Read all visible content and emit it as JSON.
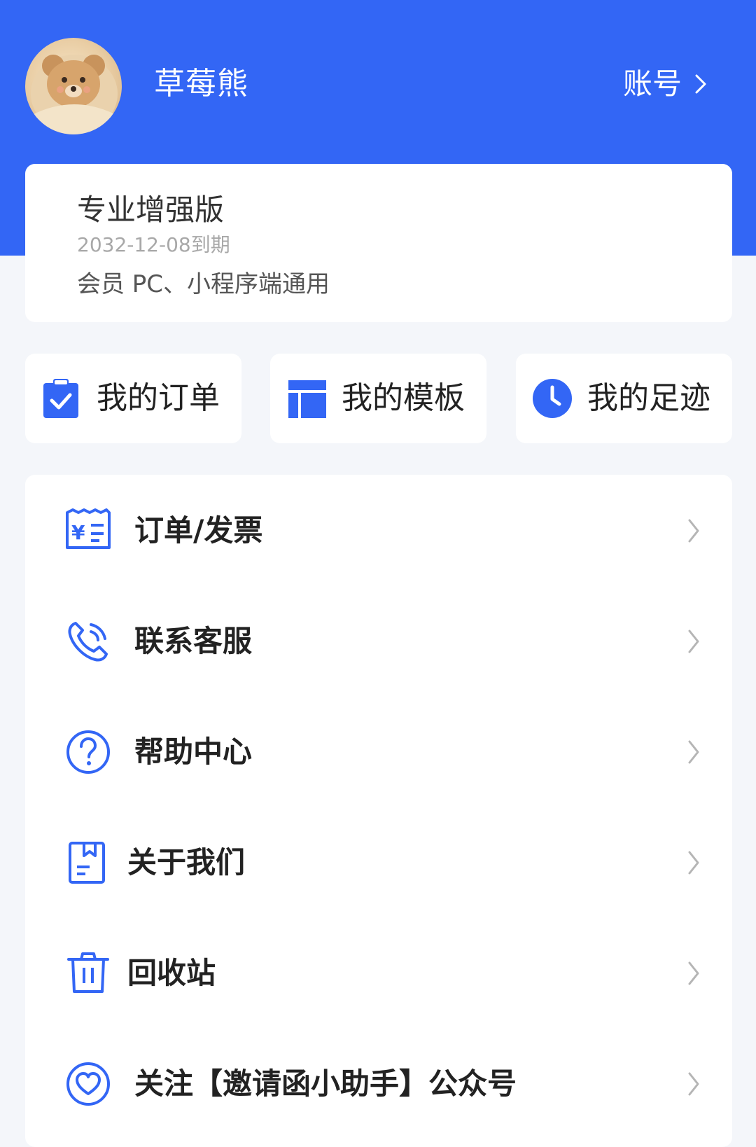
{
  "profile": {
    "username": "草莓熊",
    "account_label": "账号"
  },
  "membership": {
    "title": "专业增强版",
    "expire": "2032-12-08到期",
    "description": "会员 PC、小程序端通用"
  },
  "quick_actions": [
    {
      "label": "我的订单",
      "icon": "clipboard-check-icon"
    },
    {
      "label": "我的模板",
      "icon": "template-layout-icon"
    },
    {
      "label": "我的足迹",
      "icon": "clock-icon"
    }
  ],
  "menu": [
    {
      "label": "订单/发票",
      "icon": "invoice-icon"
    },
    {
      "label": "联系客服",
      "icon": "phone-icon"
    },
    {
      "label": "帮助中心",
      "icon": "help-icon"
    },
    {
      "label": "关于我们",
      "icon": "about-icon"
    },
    {
      "label": "回收站",
      "icon": "trash-icon"
    },
    {
      "label": "关注【邀请函小助手】公众号",
      "icon": "heart-icon"
    }
  ],
  "colors": {
    "brand": "#3366f5",
    "page_bg": "#f4f6fa",
    "card_bg": "#ffffff",
    "text_primary": "#222222",
    "text_muted": "#a8a8a8",
    "arrow": "#b5b5b5"
  }
}
